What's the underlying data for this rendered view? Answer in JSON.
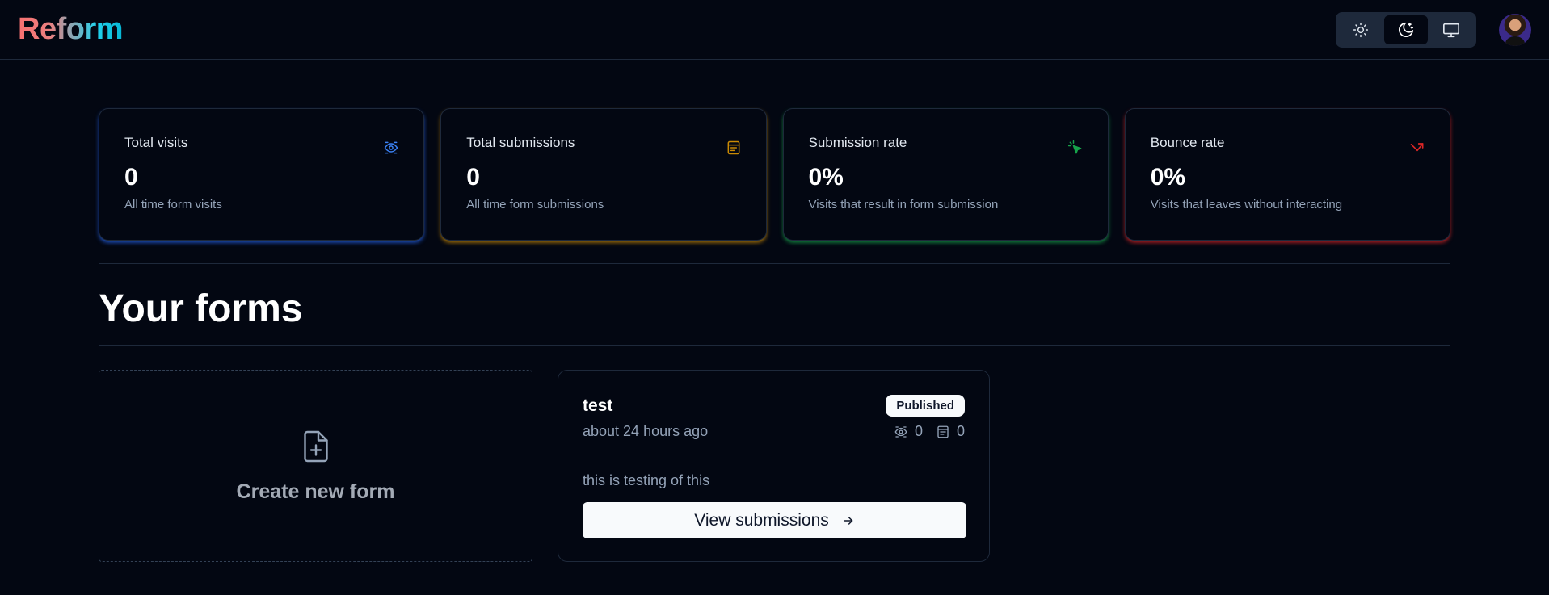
{
  "app": {
    "logo": "Reform"
  },
  "theme_toggle": {
    "options": [
      {
        "name": "light",
        "icon": "sun-icon"
      },
      {
        "name": "dark",
        "icon": "moon-icon",
        "active": true
      },
      {
        "name": "system",
        "icon": "monitor-icon"
      }
    ]
  },
  "stats": [
    {
      "title": "Total visits",
      "value": "0",
      "description": "All time form visits",
      "icon": "eye-icon",
      "color": "#2563eb"
    },
    {
      "title": "Total submissions",
      "value": "0",
      "description": "All time form submissions",
      "icon": "form-icon",
      "color": "#ca8a04"
    },
    {
      "title": "Submission rate",
      "value": "0%",
      "description": "Visits that result in form submission",
      "icon": "pointer-icon",
      "color": "#16a34a"
    },
    {
      "title": "Bounce rate",
      "value": "0%",
      "description": "Visits that leaves without interacting",
      "icon": "split-arrow-icon",
      "color": "#dc2626"
    }
  ],
  "page": {
    "title": "Your forms"
  },
  "create_form": {
    "label": "Create new form",
    "icon": "file-plus-icon"
  },
  "forms": [
    {
      "name": "test",
      "status": "Published",
      "time": "about 24 hours ago",
      "visits": "0",
      "submissions": "0",
      "description": "this is testing of this",
      "action_label": "View submissions"
    }
  ]
}
